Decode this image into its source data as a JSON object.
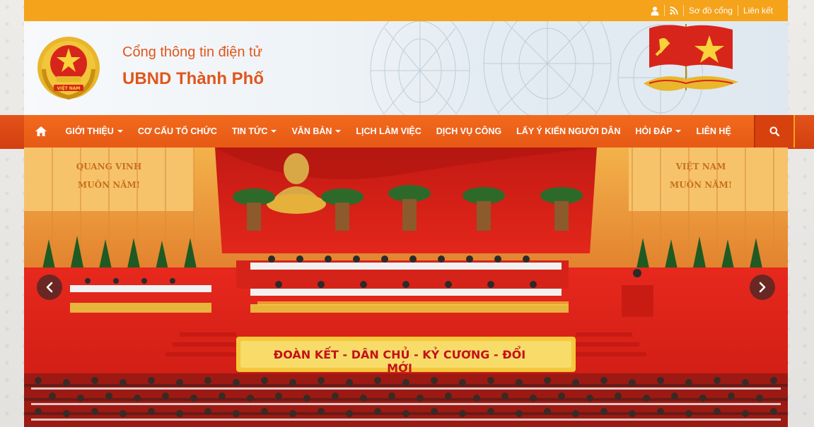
{
  "topbar": {
    "user_icon": "user-icon",
    "rss_icon": "rss-icon",
    "sitemap_label": "Sơ đồ cổng",
    "links_label": "Liên kết"
  },
  "header": {
    "subtitle": "Cổng thông tin điện tử",
    "title": "UBND Thành Phố",
    "emblem_text": "VIỆT NAM"
  },
  "nav": {
    "home_icon": "home-icon",
    "items": [
      {
        "label": "GIỚI THIỆU",
        "dropdown": true
      },
      {
        "label": "CƠ CẤU TỔ CHỨC",
        "dropdown": false
      },
      {
        "label": "TIN TỨC",
        "dropdown": true
      },
      {
        "label": "VĂN BẢN",
        "dropdown": true
      },
      {
        "label": "LỊCH LÀM VIỆC",
        "dropdown": false
      },
      {
        "label": "DỊCH VỤ CÔNG",
        "dropdown": false
      },
      {
        "label": "LẤY Ý KIẾN NGƯỜI DÂN",
        "dropdown": false
      },
      {
        "label": "HỎI ĐÁP",
        "dropdown": true
      },
      {
        "label": "LIÊN HỆ",
        "dropdown": false
      }
    ],
    "search_icon": "search-icon"
  },
  "slider": {
    "banner_text": "ĐOÀN KẾT - DÂN CHỦ - KỶ CƯƠNG - ĐỔI MỚI",
    "wall_left_1": "QUANG VINH",
    "wall_left_2": "MUÔN NĂM!",
    "wall_right_1": "VIỆT NAM",
    "wall_right_2": "MUÔN NĂM!",
    "prev_icon": "chevron-left-icon",
    "next_icon": "chevron-right-icon"
  },
  "colors": {
    "topbar": "#f4a31b",
    "nav": "#ee6219",
    "brand_text": "#e0561c"
  }
}
